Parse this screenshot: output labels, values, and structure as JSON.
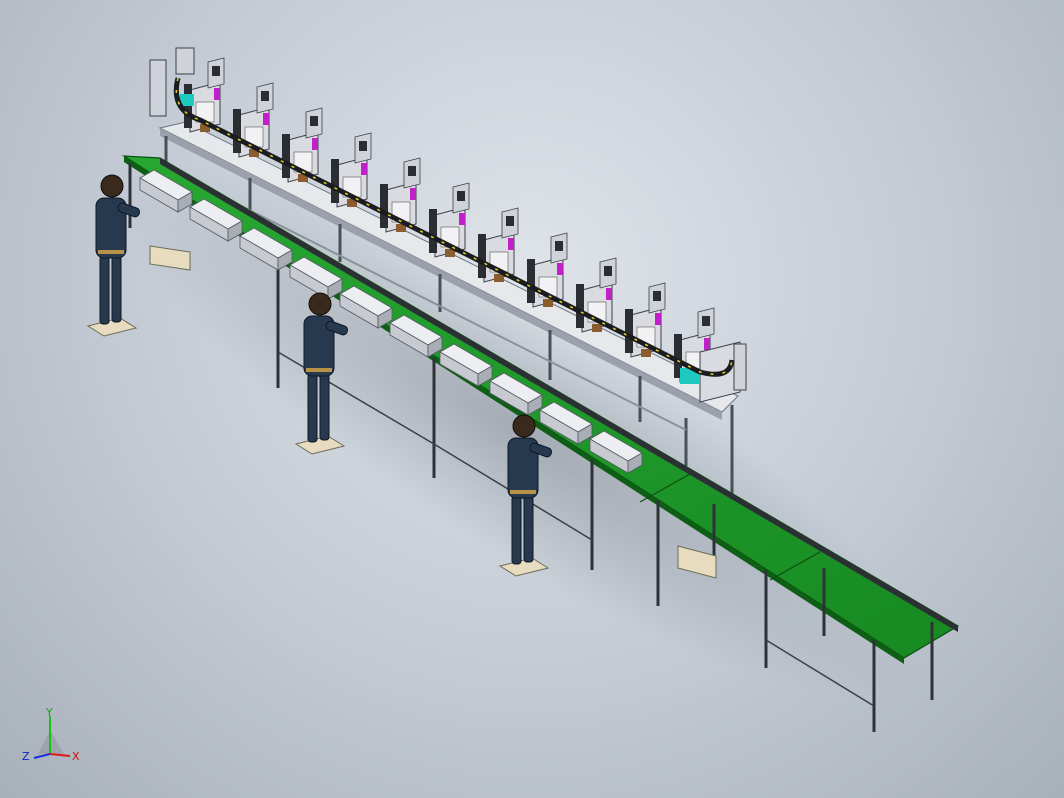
{
  "triad": {
    "x_label": "X",
    "y_label": "Y",
    "z_label": "Z",
    "x_color": "#e01818",
    "y_color": "#18c018",
    "z_color": "#1830e0"
  },
  "colors": {
    "belt": "#1f9a2a",
    "belt_dark": "#137019",
    "belt_edge": "#0b4f10",
    "frame": "#9ea6b0",
    "frame_dark": "#4c535c",
    "leg": "#3a3f46",
    "product": "#dcdee2",
    "station_panel": "#d9dbe0",
    "station_accent": "#c020c8",
    "worker_body": "#27394e",
    "worker_skin": "#3a2a1e",
    "chain": "#1a1c20"
  }
}
